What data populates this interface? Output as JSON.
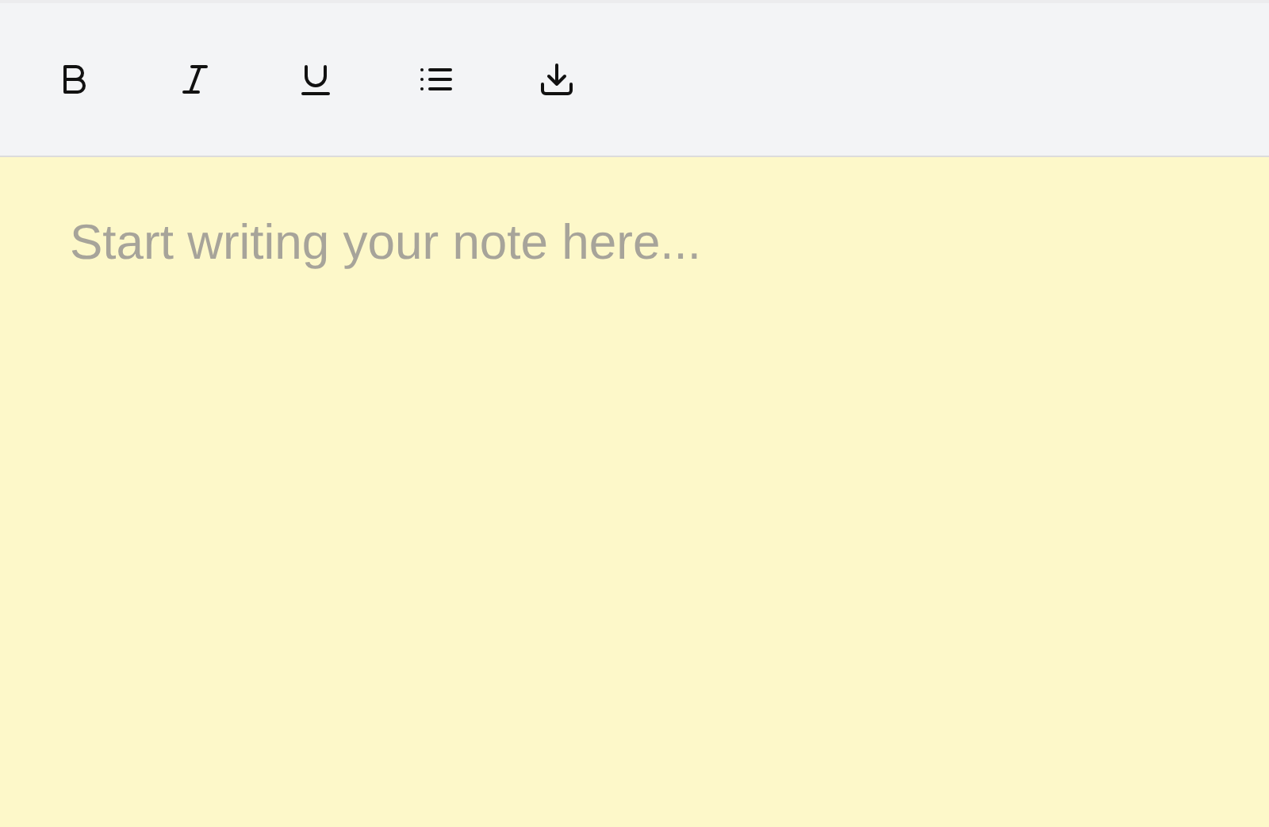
{
  "toolbar": {
    "buttons": [
      {
        "kind": "bold"
      },
      {
        "kind": "italic"
      },
      {
        "kind": "underline"
      },
      {
        "kind": "list"
      },
      {
        "kind": "download"
      }
    ]
  },
  "editor": {
    "placeholder": "Start writing your note here..."
  }
}
